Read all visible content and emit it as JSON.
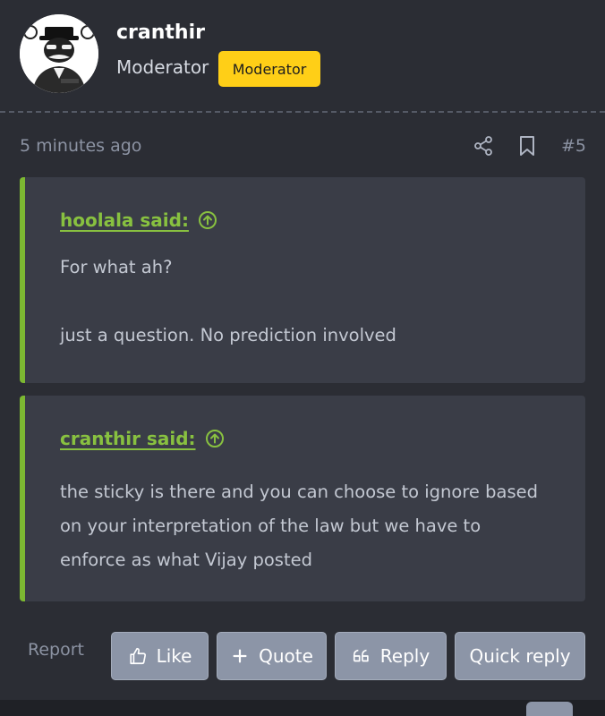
{
  "author": {
    "username": "cranthir",
    "user_title": "Moderator",
    "badge": "Moderator",
    "avatar_text": "Cranthir"
  },
  "meta": {
    "timestamp": "5 minutes ago",
    "post_number": "#5"
  },
  "quotes": [
    {
      "attribution": "hoolala said:",
      "lines": [
        "For what ah?",
        "just a question. No prediction involved"
      ]
    },
    {
      "attribution": "cranthir said:",
      "lines": [
        "the sticky is there and you can choose to ignore based",
        "on your interpretation of the law but we have to",
        "enforce as what Vijay posted"
      ]
    }
  ],
  "actions": {
    "report": "Report",
    "like": "Like",
    "quote": "Quote",
    "reply": "Reply",
    "quick_reply": "Quick reply"
  },
  "colors": {
    "background": "#2b2d34",
    "quote_bg": "#3a3d47",
    "accent_green": "#7cb832",
    "badge_yellow": "#ffcf17",
    "button_bg": "#8c95a7"
  },
  "icons": {
    "share": "share-icon",
    "bookmark": "bookmark-icon",
    "jump": "arrow-up-circle-icon",
    "like": "thumbs-up-icon",
    "quote": "plus-icon",
    "reply": "quote-marks-icon"
  }
}
